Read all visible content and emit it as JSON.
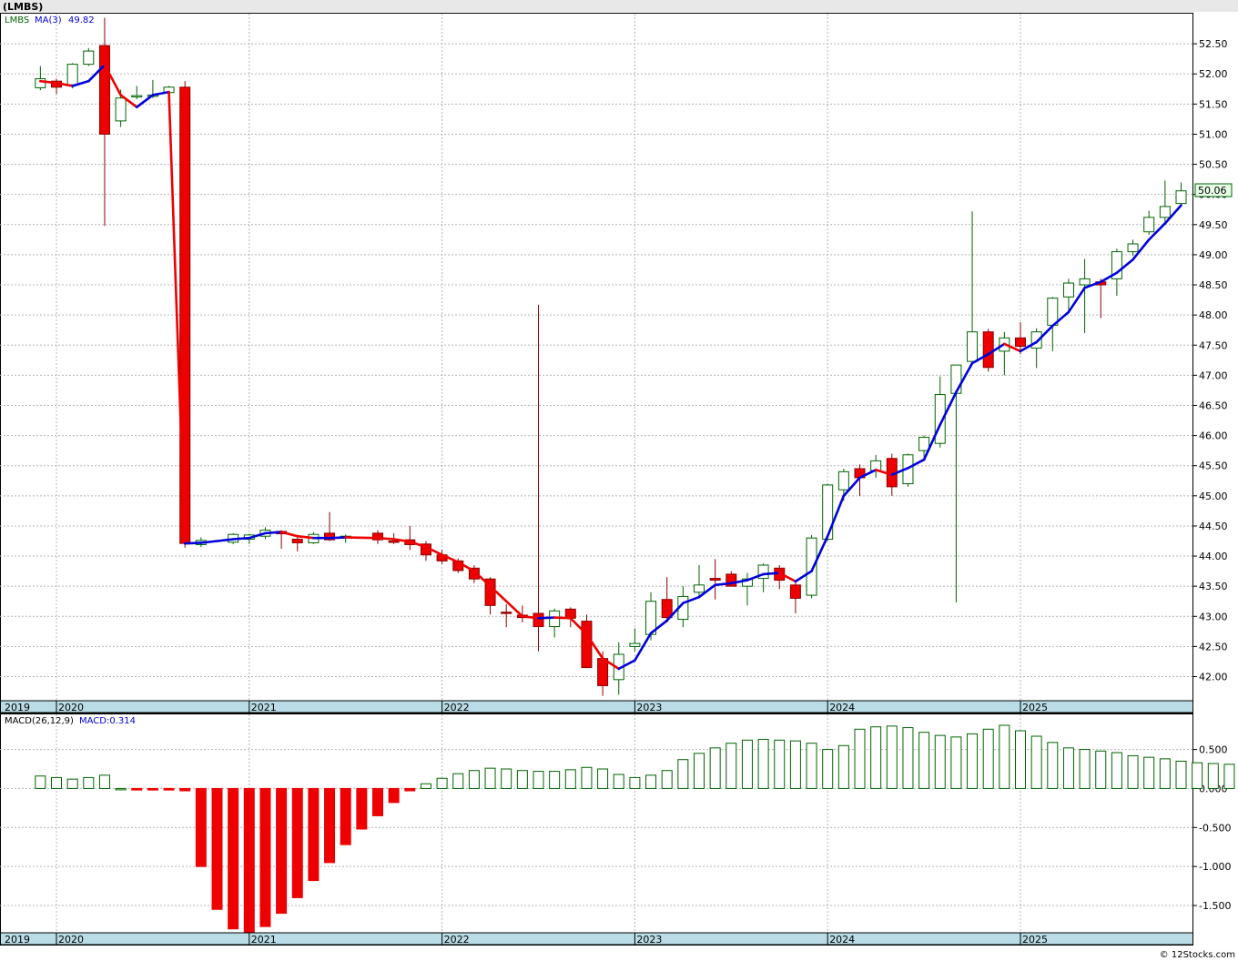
{
  "header": {
    "symbol": "(LMBS)"
  },
  "price_panel": {
    "ticker_label": "LMBS",
    "ma_label": "MA(3)",
    "ma_value": "49.82",
    "last_price_tag": "50.06"
  },
  "macd_panel": {
    "label": "MACD(26,12,9)",
    "value_label": "MACD:0.314"
  },
  "watermark": "© 12Stocks.com",
  "colors": {
    "up": "#ffffff",
    "up_outline": "#006400",
    "down": "#ee0000",
    "down_outline": "#8b0000",
    "ma_up": "#0000dd",
    "ma_down": "#ee0000",
    "macd_pos_outline": "#006400",
    "macd_neg": "#ee0000",
    "axis_band": "#b9dce6",
    "grid": "#b4b4b4"
  },
  "chart_data": [
    {
      "type": "candlestick",
      "title": "(LMBS)",
      "interval": "monthly",
      "x_tick_labels": [
        "2019",
        "2020",
        "2021",
        "2022",
        "2023",
        "2024",
        "2025"
      ],
      "ylim": [
        41.6,
        53.0
      ],
      "y_ticks": [
        "42.00",
        "42.50",
        "43.00",
        "43.50",
        "44.00",
        "44.50",
        "45.00",
        "45.50",
        "46.00",
        "46.50",
        "47.00",
        "47.50",
        "48.00",
        "48.50",
        "49.00",
        "49.50",
        "50.00",
        "50.50",
        "51.00",
        "51.50",
        "52.00",
        "52.50"
      ],
      "grid": true,
      "candles": [
        {
          "date": "2019-12",
          "o": 51.77,
          "h": 52.13,
          "l": 51.73,
          "c": 51.92
        },
        {
          "date": "2020-01",
          "o": 51.88,
          "h": 51.92,
          "l": 51.67,
          "c": 51.78
        },
        {
          "date": "2020-02",
          "o": 51.82,
          "h": 52.18,
          "l": 51.76,
          "c": 52.16
        },
        {
          "date": "2020-03",
          "o": 52.16,
          "h": 52.43,
          "l": 52.13,
          "c": 52.38
        },
        {
          "date": "2020-04",
          "o": 52.47,
          "h": 52.93,
          "l": 49.48,
          "c": 51.0
        },
        {
          "date": "2020-05",
          "o": 51.22,
          "h": 51.74,
          "l": 51.12,
          "c": 51.6
        },
        {
          "date": "2020-06",
          "o": 51.64,
          "h": 51.8,
          "l": 51.58,
          "c": 51.64
        },
        {
          "date": "2020-07",
          "o": 51.65,
          "h": 51.9,
          "l": 51.6,
          "c": 51.65
        },
        {
          "date": "2020-08",
          "o": 51.69,
          "h": 51.8,
          "l": 51.66,
          "c": 51.78
        },
        {
          "date": "2020-09",
          "o": 51.78,
          "h": 51.88,
          "l": 44.14,
          "c": 44.21
        },
        {
          "date": "2020-10",
          "o": 44.19,
          "h": 44.31,
          "l": 44.15,
          "c": 44.26
        },
        {
          "date": "2020-12",
          "o": 44.23,
          "h": 44.38,
          "l": 44.2,
          "c": 44.36
        },
        {
          "date": "2021-01",
          "o": 44.28,
          "h": 44.37,
          "l": 44.2,
          "c": 44.35
        },
        {
          "date": "2021-02",
          "o": 44.33,
          "h": 44.48,
          "l": 44.28,
          "c": 44.43
        },
        {
          "date": "2021-03",
          "o": 44.41,
          "h": 44.43,
          "l": 44.12,
          "c": 44.37
        },
        {
          "date": "2021-04",
          "o": 44.28,
          "h": 44.35,
          "l": 44.08,
          "c": 44.22
        },
        {
          "date": "2021-05",
          "o": 44.22,
          "h": 44.4,
          "l": 44.2,
          "c": 44.36
        },
        {
          "date": "2021-06",
          "o": 44.38,
          "h": 44.73,
          "l": 44.25,
          "c": 44.27
        },
        {
          "date": "2021-07",
          "o": 44.32,
          "h": 44.36,
          "l": 44.22,
          "c": 44.33
        },
        {
          "date": "2021-09",
          "o": 44.38,
          "h": 44.43,
          "l": 44.2,
          "c": 44.27
        },
        {
          "date": "2021-10",
          "o": 44.25,
          "h": 44.38,
          "l": 44.2,
          "c": 44.24
        },
        {
          "date": "2021-11",
          "o": 44.27,
          "h": 44.5,
          "l": 44.1,
          "c": 44.19
        },
        {
          "date": "2021-12",
          "o": 44.2,
          "h": 44.25,
          "l": 43.92,
          "c": 44.02
        },
        {
          "date": "2022-01",
          "o": 44.02,
          "h": 44.1,
          "l": 43.87,
          "c": 43.92
        },
        {
          "date": "2022-02",
          "o": 43.92,
          "h": 43.96,
          "l": 43.72,
          "c": 43.76
        },
        {
          "date": "2022-03",
          "o": 43.8,
          "h": 43.85,
          "l": 43.55,
          "c": 43.62
        },
        {
          "date": "2022-04",
          "o": 43.62,
          "h": 43.65,
          "l": 43.03,
          "c": 43.18
        },
        {
          "date": "2022-05",
          "o": 43.07,
          "h": 43.2,
          "l": 42.82,
          "c": 43.05
        },
        {
          "date": "2022-06",
          "o": 43.02,
          "h": 43.18,
          "l": 42.9,
          "c": 42.98
        },
        {
          "date": "2022-07",
          "o": 43.05,
          "h": 48.17,
          "l": 42.42,
          "c": 42.83
        },
        {
          "date": "2022-08",
          "o": 42.83,
          "h": 43.13,
          "l": 42.65,
          "c": 43.09
        },
        {
          "date": "2022-09",
          "o": 43.12,
          "h": 43.15,
          "l": 42.82,
          "c": 42.97
        },
        {
          "date": "2022-10",
          "o": 42.92,
          "h": 43.03,
          "l": 42.15,
          "c": 42.15
        },
        {
          "date": "2022-11",
          "o": 42.3,
          "h": 42.42,
          "l": 41.68,
          "c": 41.85
        },
        {
          "date": "2022-12",
          "o": 41.95,
          "h": 42.57,
          "l": 41.7,
          "c": 42.37
        },
        {
          "date": "2023-01",
          "o": 42.5,
          "h": 42.8,
          "l": 42.42,
          "c": 42.55
        },
        {
          "date": "2023-02",
          "o": 42.7,
          "h": 43.4,
          "l": 42.6,
          "c": 43.25
        },
        {
          "date": "2023-03",
          "o": 43.28,
          "h": 43.65,
          "l": 42.9,
          "c": 42.98
        },
        {
          "date": "2023-04",
          "o": 42.95,
          "h": 43.5,
          "l": 42.82,
          "c": 43.33
        },
        {
          "date": "2023-05",
          "o": 43.4,
          "h": 43.85,
          "l": 43.3,
          "c": 43.52
        },
        {
          "date": "2023-06",
          "o": 43.63,
          "h": 43.95,
          "l": 43.28,
          "c": 43.6
        },
        {
          "date": "2023-07",
          "o": 43.7,
          "h": 43.75,
          "l": 43.5,
          "c": 43.5
        },
        {
          "date": "2023-08",
          "o": 43.5,
          "h": 43.72,
          "l": 43.18,
          "c": 43.62
        },
        {
          "date": "2023-09",
          "o": 43.63,
          "h": 43.88,
          "l": 43.4,
          "c": 43.85
        },
        {
          "date": "2023-10",
          "o": 43.8,
          "h": 43.85,
          "l": 43.45,
          "c": 43.6
        },
        {
          "date": "2023-11",
          "o": 43.52,
          "h": 43.6,
          "l": 43.05,
          "c": 43.3
        },
        {
          "date": "2023-12",
          "o": 43.35,
          "h": 44.35,
          "l": 43.3,
          "c": 44.3
        },
        {
          "date": "2024-01",
          "o": 44.28,
          "h": 45.2,
          "l": 44.25,
          "c": 45.18
        },
        {
          "date": "2024-02",
          "o": 45.1,
          "h": 45.45,
          "l": 44.92,
          "c": 45.4
        },
        {
          "date": "2024-03",
          "o": 45.45,
          "h": 45.52,
          "l": 45.0,
          "c": 45.3
        },
        {
          "date": "2024-04",
          "o": 45.42,
          "h": 45.68,
          "l": 45.3,
          "c": 45.58
        },
        {
          "date": "2024-05",
          "o": 45.62,
          "h": 45.7,
          "l": 45.0,
          "c": 45.15
        },
        {
          "date": "2024-06",
          "o": 45.2,
          "h": 45.7,
          "l": 45.15,
          "c": 45.68
        },
        {
          "date": "2024-07",
          "o": 45.75,
          "h": 46.0,
          "l": 45.6,
          "c": 45.97
        },
        {
          "date": "2024-08",
          "o": 45.87,
          "h": 46.98,
          "l": 45.8,
          "c": 46.68
        },
        {
          "date": "2024-09",
          "o": 46.7,
          "h": 47.17,
          "l": 43.23,
          "c": 47.17
        },
        {
          "date": "2024-10",
          "o": 47.23,
          "h": 49.72,
          "l": 47.2,
          "c": 47.72
        },
        {
          "date": "2024-11",
          "o": 47.72,
          "h": 47.77,
          "l": 47.06,
          "c": 47.13
        },
        {
          "date": "2024-12",
          "o": 47.4,
          "h": 47.72,
          "l": 47.0,
          "c": 47.62
        },
        {
          "date": "2025-01",
          "o": 47.62,
          "h": 47.88,
          "l": 47.35,
          "c": 47.48
        },
        {
          "date": "2025-02",
          "o": 47.45,
          "h": 47.78,
          "l": 47.12,
          "c": 47.72
        },
        {
          "date": "2025-03",
          "o": 47.83,
          "h": 48.3,
          "l": 47.4,
          "c": 48.28
        },
        {
          "date": "2025-04",
          "o": 48.3,
          "h": 48.6,
          "l": 48.05,
          "c": 48.53
        },
        {
          "date": "2025-05",
          "o": 48.5,
          "h": 48.93,
          "l": 47.7,
          "c": 48.6
        },
        {
          "date": "2025-06",
          "o": 48.55,
          "h": 48.6,
          "l": 47.95,
          "c": 48.5
        },
        {
          "date": "2025-07",
          "o": 48.6,
          "h": 49.1,
          "l": 48.32,
          "c": 49.05
        },
        {
          "date": "2025-08",
          "o": 49.05,
          "h": 49.25,
          "l": 48.98,
          "c": 49.18
        },
        {
          "date": "2025-09",
          "o": 49.38,
          "h": 49.73,
          "l": 49.33,
          "c": 49.62
        },
        {
          "date": "2025-10",
          "o": 49.62,
          "h": 50.23,
          "l": 49.55,
          "c": 49.8
        },
        {
          "date": "2025-11",
          "o": 49.85,
          "h": 50.2,
          "l": 49.82,
          "c": 50.06
        }
      ],
      "ma3": [
        51.88,
        51.85,
        51.8,
        51.88,
        52.15,
        51.65,
        51.45,
        51.65,
        51.7,
        44.21,
        44.22,
        44.28,
        44.3,
        44.38,
        44.4,
        44.33,
        44.3,
        44.3,
        44.31,
        44.3,
        44.28,
        44.24,
        44.15,
        44.02,
        43.9,
        43.75,
        43.5,
        43.25,
        43.0,
        42.97,
        42.98,
        42.97,
        42.7,
        42.3,
        42.13,
        42.27,
        42.72,
        42.93,
        43.22,
        43.32,
        43.52,
        43.55,
        43.6,
        43.7,
        43.72,
        43.58,
        43.75,
        44.33,
        45.0,
        45.3,
        45.43,
        45.35,
        45.46,
        45.6,
        46.18,
        46.72,
        47.2,
        47.35,
        47.52,
        47.4,
        47.55,
        47.82,
        48.05,
        48.45,
        48.55,
        48.7,
        48.92,
        49.25,
        49.52,
        49.82
      ]
    },
    {
      "type": "bar",
      "title": "MACD(26,12,9)",
      "current_value": 0.314,
      "ylim": [
        -1.85,
        0.95
      ],
      "y_ticks": [
        "0.500",
        "0.000",
        "-0.500",
        "-1.000",
        "-1.500"
      ],
      "x_tick_labels": [
        "2019",
        "2020",
        "2021",
        "2022",
        "2023",
        "2024",
        "2025"
      ],
      "grid": true,
      "values": [
        0.16,
        0.14,
        0.12,
        0.14,
        0.17,
        0.0,
        -0.02,
        -0.02,
        -0.02,
        -0.03,
        -1.0,
        -1.55,
        -1.8,
        -1.85,
        -1.77,
        -1.6,
        -1.4,
        -1.18,
        -0.95,
        -0.72,
        -0.52,
        -0.35,
        -0.18,
        -0.03,
        0.06,
        0.13,
        0.19,
        0.23,
        0.26,
        0.25,
        0.23,
        0.22,
        0.22,
        0.24,
        0.27,
        0.25,
        0.18,
        0.14,
        0.17,
        0.23,
        0.37,
        0.45,
        0.52,
        0.58,
        0.62,
        0.63,
        0.62,
        0.61,
        0.58,
        0.5,
        0.55,
        0.76,
        0.79,
        0.8,
        0.78,
        0.72,
        0.68,
        0.66,
        0.7,
        0.76,
        0.81,
        0.74,
        0.67,
        0.59,
        0.52,
        0.5,
        0.48,
        0.46,
        0.42,
        0.4,
        0.38,
        0.35,
        0.33,
        0.32,
        0.31
      ]
    }
  ]
}
